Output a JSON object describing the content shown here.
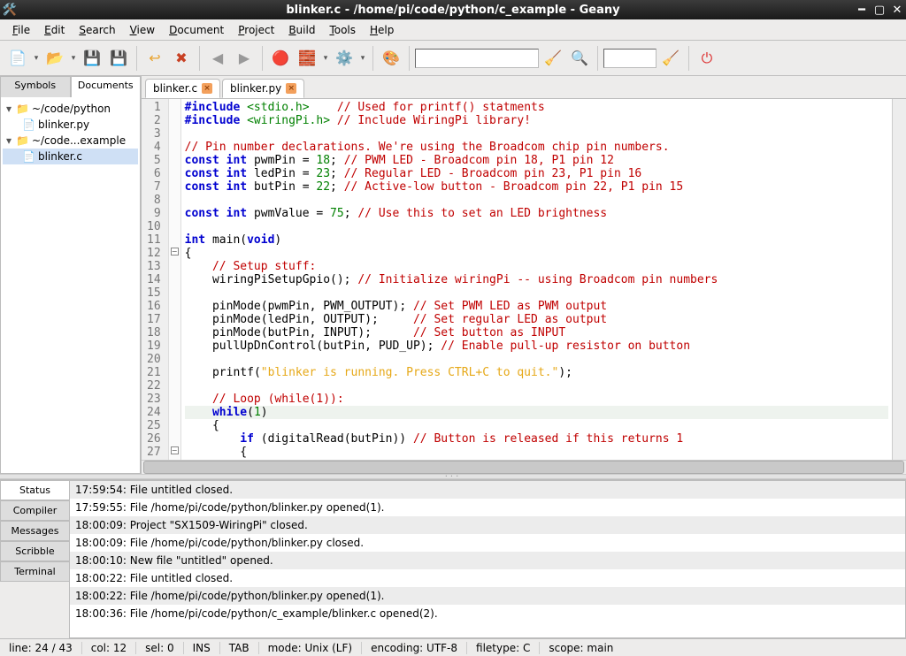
{
  "title": "blinker.c - /home/pi/code/python/c_example - Geany",
  "menu": [
    "File",
    "Edit",
    "Search",
    "View",
    "Document",
    "Project",
    "Build",
    "Tools",
    "Help"
  ],
  "sidebar": {
    "tabs": [
      "Symbols",
      "Documents"
    ],
    "active_tab": "Documents",
    "nodes": [
      {
        "exp": "▾",
        "icon": "folder",
        "label": "~/code/python",
        "children": [
          {
            "icon": "file",
            "label": "blinker.py"
          }
        ]
      },
      {
        "exp": "▾",
        "icon": "folder",
        "label": "~/code...example",
        "children": [
          {
            "icon": "file",
            "label": "blinker.c",
            "sel": true
          }
        ]
      }
    ]
  },
  "editor_tabs": [
    {
      "label": "blinker.c",
      "active": true
    },
    {
      "label": "blinker.py",
      "active": false
    }
  ],
  "bottom_tabs": [
    "Status",
    "Compiler",
    "Messages",
    "Scribble",
    "Terminal"
  ],
  "bottom_active": "Status",
  "messages": [
    "17:59:54: File untitled closed.",
    "17:59:55: File /home/pi/code/python/blinker.py opened(1).",
    "18:00:09: Project \"SX1509-WiringPi\" closed.",
    "18:00:09: File /home/pi/code/python/blinker.py closed.",
    "18:00:10: New file \"untitled\" opened.",
    "18:00:22: File untitled closed.",
    "18:00:22: File /home/pi/code/python/blinker.py opened(1).",
    "18:00:36: File /home/pi/code/python/c_example/blinker.c opened(2)."
  ],
  "status": {
    "line": "line: 24 / 43",
    "col": "col: 12",
    "sel": "sel: 0",
    "ins": "INS",
    "tab": "TAB",
    "mode": "mode: Unix (LF)",
    "enc": "encoding: UTF-8",
    "ftype": "filetype: C",
    "scope": "scope: main"
  },
  "code": {
    "lines": 27,
    "highlight_line": 24,
    "tokens": [
      [
        [
          "kw",
          "#include"
        ],
        [
          "sp",
          " "
        ],
        [
          "inc",
          "<stdio.h>"
        ],
        [
          "sp",
          "    "
        ],
        [
          "cm",
          "// Used for printf() statments"
        ]
      ],
      [
        [
          "kw",
          "#include"
        ],
        [
          "sp",
          " "
        ],
        [
          "inc",
          "<wiringPi.h>"
        ],
        [
          "sp",
          " "
        ],
        [
          "cm",
          "// Include WiringPi library!"
        ]
      ],
      [],
      [
        [
          "cm",
          "// Pin number declarations. We're using the Broadcom chip pin numbers."
        ]
      ],
      [
        [
          "kw",
          "const int"
        ],
        [
          "sp",
          " "
        ],
        [
          "id",
          "pwmPin = "
        ],
        [
          "num",
          "18"
        ],
        [
          "id",
          ";"
        ],
        [
          "sp",
          " "
        ],
        [
          "cm",
          "// PWM LED - Broadcom pin 18, P1 pin 12"
        ]
      ],
      [
        [
          "kw",
          "const int"
        ],
        [
          "sp",
          " "
        ],
        [
          "id",
          "ledPin = "
        ],
        [
          "num",
          "23"
        ],
        [
          "id",
          ";"
        ],
        [
          "sp",
          " "
        ],
        [
          "cm",
          "// Regular LED - Broadcom pin 23, P1 pin 16"
        ]
      ],
      [
        [
          "kw",
          "const int"
        ],
        [
          "sp",
          " "
        ],
        [
          "id",
          "butPin = "
        ],
        [
          "num",
          "22"
        ],
        [
          "id",
          ";"
        ],
        [
          "sp",
          " "
        ],
        [
          "cm",
          "// Active-low button - Broadcom pin 22, P1 pin 15"
        ]
      ],
      [],
      [
        [
          "kw",
          "const int"
        ],
        [
          "sp",
          " "
        ],
        [
          "id",
          "pwmValue = "
        ],
        [
          "num",
          "75"
        ],
        [
          "id",
          ";"
        ],
        [
          "sp",
          " "
        ],
        [
          "cm",
          "// Use this to set an LED brightness"
        ]
      ],
      [],
      [
        [
          "kw",
          "int"
        ],
        [
          "sp",
          " "
        ],
        [
          "fn",
          "main"
        ],
        [
          "op",
          "("
        ],
        [
          "kw",
          "void"
        ],
        [
          "op",
          ")"
        ]
      ],
      [
        [
          "op",
          "{"
        ]
      ],
      [
        [
          "sp",
          "    "
        ],
        [
          "cm",
          "// Setup stuff:"
        ]
      ],
      [
        [
          "sp",
          "    "
        ],
        [
          "id",
          "wiringPiSetupGpio"
        ],
        [
          "op",
          "();"
        ],
        [
          "sp",
          " "
        ],
        [
          "cm",
          "// Initialize wiringPi -- using Broadcom pin numbers"
        ]
      ],
      [],
      [
        [
          "sp",
          "    "
        ],
        [
          "id",
          "pinMode"
        ],
        [
          "op",
          "("
        ],
        [
          "id",
          "pwmPin"
        ],
        [
          "op",
          ", "
        ],
        [
          "id",
          "PWM_OUTPUT"
        ],
        [
          "op",
          ");"
        ],
        [
          "sp",
          " "
        ],
        [
          "cm",
          "// Set PWM LED as PWM output"
        ]
      ],
      [
        [
          "sp",
          "    "
        ],
        [
          "id",
          "pinMode"
        ],
        [
          "op",
          "("
        ],
        [
          "id",
          "ledPin"
        ],
        [
          "op",
          ", "
        ],
        [
          "id",
          "OUTPUT"
        ],
        [
          "op",
          ");"
        ],
        [
          "sp",
          "     "
        ],
        [
          "cm",
          "// Set regular LED as output"
        ]
      ],
      [
        [
          "sp",
          "    "
        ],
        [
          "id",
          "pinMode"
        ],
        [
          "op",
          "("
        ],
        [
          "id",
          "butPin"
        ],
        [
          "op",
          ", "
        ],
        [
          "id",
          "INPUT"
        ],
        [
          "op",
          ");"
        ],
        [
          "sp",
          "      "
        ],
        [
          "cm",
          "// Set button as INPUT"
        ]
      ],
      [
        [
          "sp",
          "    "
        ],
        [
          "id",
          "pullUpDnControl"
        ],
        [
          "op",
          "("
        ],
        [
          "id",
          "butPin"
        ],
        [
          "op",
          ", "
        ],
        [
          "id",
          "PUD_UP"
        ],
        [
          "op",
          ");"
        ],
        [
          "sp",
          " "
        ],
        [
          "cm",
          "// Enable pull-up resistor on button"
        ]
      ],
      [],
      [
        [
          "sp",
          "    "
        ],
        [
          "id",
          "printf"
        ],
        [
          "op",
          "("
        ],
        [
          "str",
          "\"blinker is running. Press CTRL+C to quit.\""
        ],
        [
          "op",
          ");"
        ]
      ],
      [],
      [
        [
          "sp",
          "    "
        ],
        [
          "cm",
          "// Loop (while(1)):"
        ]
      ],
      [
        [
          "sp",
          "    "
        ],
        [
          "kw",
          "while"
        ],
        [
          "op",
          "("
        ],
        [
          "num",
          "1"
        ],
        [
          "op",
          ")"
        ]
      ],
      [
        [
          "sp",
          "    "
        ],
        [
          "op",
          "{"
        ]
      ],
      [
        [
          "sp",
          "        "
        ],
        [
          "kw",
          "if"
        ],
        [
          "sp",
          " "
        ],
        [
          "op",
          "("
        ],
        [
          "id",
          "digitalRead"
        ],
        [
          "op",
          "("
        ],
        [
          "id",
          "butPin"
        ],
        [
          "op",
          "))"
        ],
        [
          "sp",
          " "
        ],
        [
          "cm",
          "// Button is released if this returns 1"
        ]
      ],
      [
        [
          "sp",
          "        "
        ],
        [
          "op",
          "{"
        ]
      ]
    ]
  },
  "chart_data": null
}
